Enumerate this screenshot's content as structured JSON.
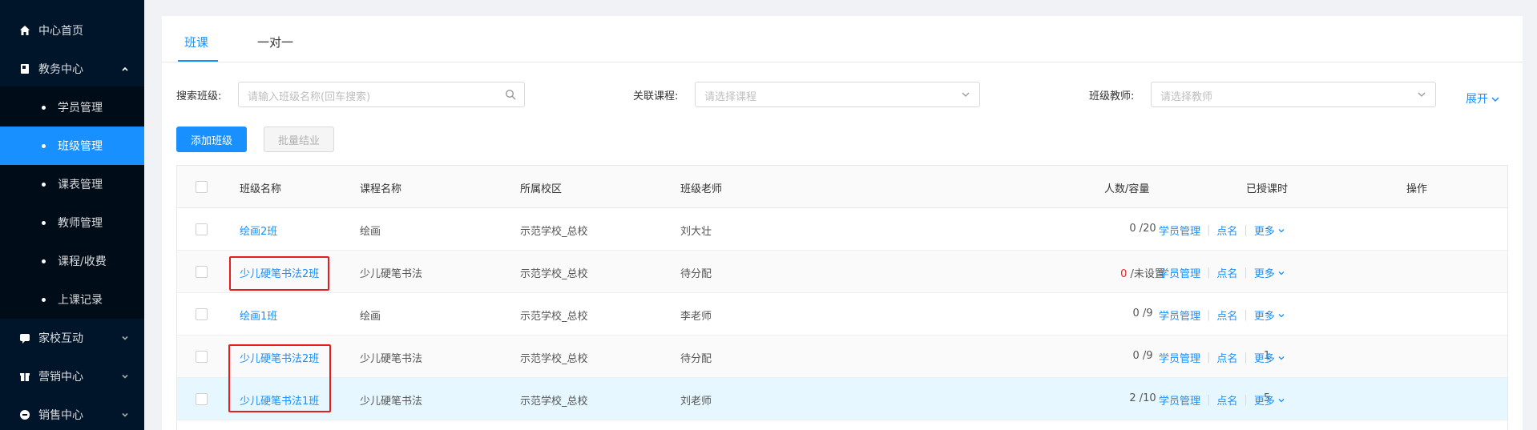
{
  "sidebar": {
    "items": [
      {
        "label": "中心首页",
        "icon": "home-icon"
      },
      {
        "label": "教务中心",
        "icon": "book-icon",
        "expanded": true,
        "children": [
          "学员管理",
          "班级管理",
          "课表管理",
          "教师管理",
          "课程/收费",
          "上课记录"
        ],
        "active_child": "班级管理"
      },
      {
        "label": "家校互动",
        "icon": "chat-icon"
      },
      {
        "label": "营销中心",
        "icon": "gift-icon"
      },
      {
        "label": "销售中心",
        "icon": "sales-icon"
      }
    ]
  },
  "tabs": [
    "班课",
    "一对一"
  ],
  "active_tab": "班课",
  "filters": {
    "search_label": "搜索班级:",
    "search_placeholder": "请输入班级名称(回车搜索)",
    "course_label": "关联课程:",
    "course_placeholder": "请选择课程",
    "teacher_label": "班级教师:",
    "teacher_placeholder": "请选择教师",
    "expand_label": "展开"
  },
  "buttons": {
    "add": "添加班级",
    "batch": "批量结业"
  },
  "table": {
    "headers": [
      "班级名称",
      "课程名称",
      "所属校区",
      "班级老师",
      "人数/容量",
      "已授课时",
      "操作"
    ],
    "rows": [
      {
        "name": "绘画2班",
        "course": "绘画",
        "campus": "示范学校_总校",
        "teacher": "刘大壮",
        "count": "0",
        "capacity": "/20",
        "hours": "-"
      },
      {
        "name": "少儿硬笔书法2班",
        "course": "少儿硬笔书法",
        "campus": "示范学校_总校",
        "teacher": "待分配",
        "count": "0",
        "capacity": "/未设置",
        "hours": "-"
      },
      {
        "name": "绘画1班",
        "course": "绘画",
        "campus": "示范学校_总校",
        "teacher": "李老师",
        "count": "0",
        "capacity": "/9",
        "hours": "-"
      },
      {
        "name": "少儿硬笔书法2班",
        "course": "少儿硬笔书法",
        "campus": "示范学校_总校",
        "teacher": "待分配",
        "count": "0",
        "capacity": "/9",
        "hours": "1"
      },
      {
        "name": "少儿硬笔书法1班",
        "course": "少儿硬笔书法",
        "campus": "示范学校_总校",
        "teacher": "刘老师",
        "count": "2",
        "capacity": "/10",
        "hours": "5"
      }
    ],
    "actions": [
      "学员管理",
      "点名",
      "更多"
    ]
  },
  "colors": {
    "accent": "#1890ff",
    "sidebar_bg": "#001529",
    "highlight_box": "#e81c1c",
    "zero_count": "#f5222d"
  }
}
